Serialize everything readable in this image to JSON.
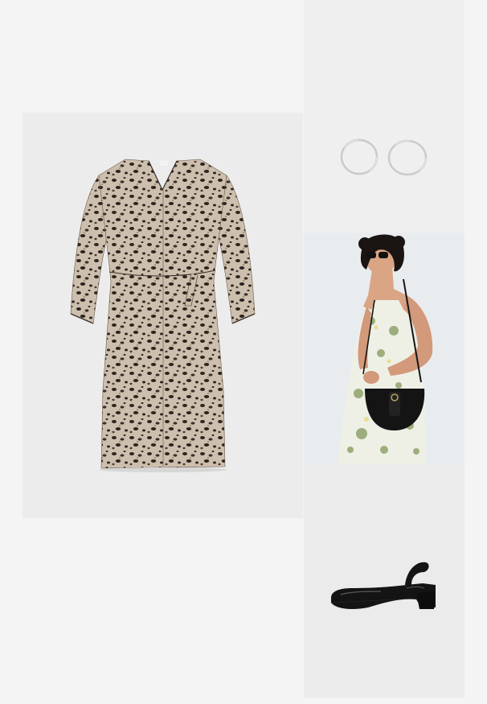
{
  "outfit": {
    "items": [
      {
        "name": "dress",
        "icon": "leopard-print-dress"
      },
      {
        "name": "earrings",
        "icon": "silver-hoop-earrings"
      },
      {
        "name": "bag",
        "icon": "black-saddle-bag"
      },
      {
        "name": "shoes",
        "icon": "black-patent-slingback-pumps"
      }
    ]
  },
  "colors": {
    "page_background": "#f4f4f4",
    "dress_tile": "#ececec",
    "earrings_tile": "#efefef",
    "bag_tile": "#e9ecee",
    "shoe_tile": "#ebebeb",
    "leopard_base": "#cdbfad",
    "leopard_spot": "#2b2520",
    "silver": "#c9cacc",
    "black_leather": "#141414",
    "floral_dress": "#eef0e6",
    "floral_leaf": "#8fa36a"
  }
}
